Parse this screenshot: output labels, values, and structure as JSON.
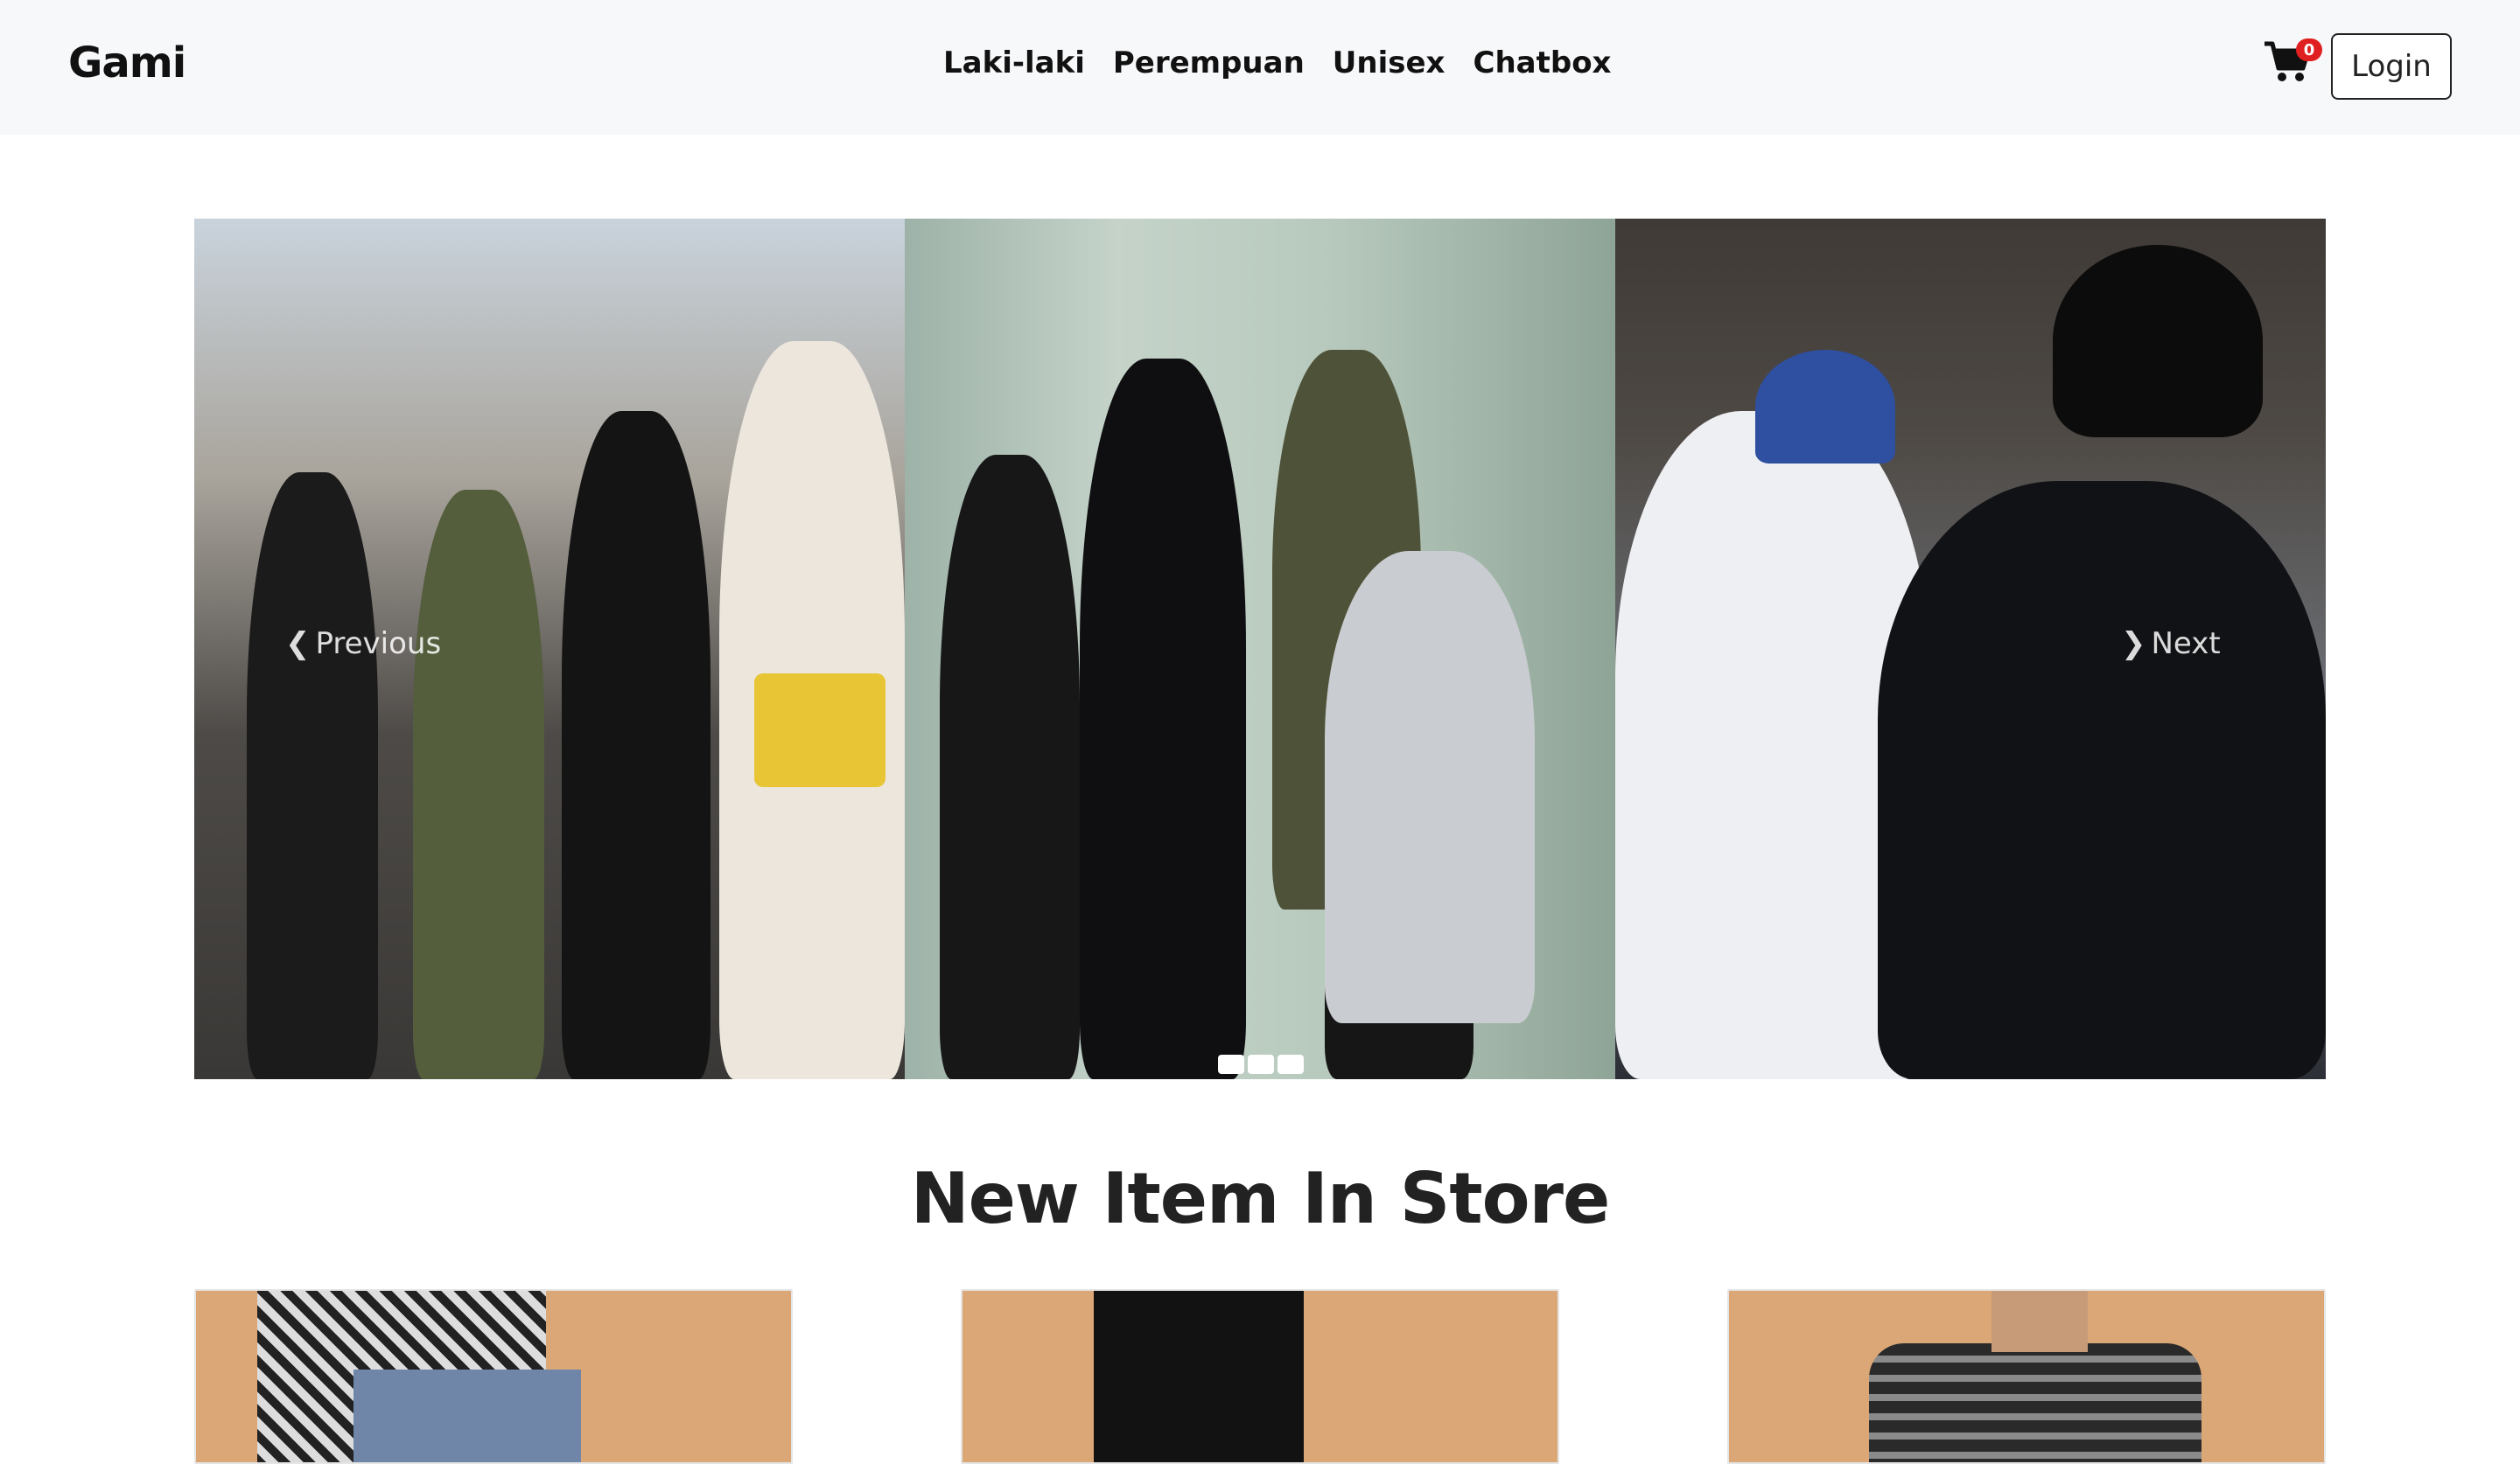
{
  "brand": "Gami",
  "nav": {
    "links": [
      "Laki-laki",
      "Perempuan",
      "Unisex",
      "Chatbox"
    ]
  },
  "cart": {
    "icon": "cart-icon",
    "count": "0",
    "badge_color": "#e02020"
  },
  "login_label": "Login",
  "carousel": {
    "prev_label": "Previous",
    "next_label": "Next",
    "prev_icon": "chevron-left-icon",
    "next_icon": "chevron-right-icon",
    "indicator_count": 3
  },
  "section": {
    "title": "New Item In Store"
  },
  "colors": {
    "navbar_bg": "#f7f8fa",
    "product_bg": "#dba776",
    "text": "#111111"
  }
}
